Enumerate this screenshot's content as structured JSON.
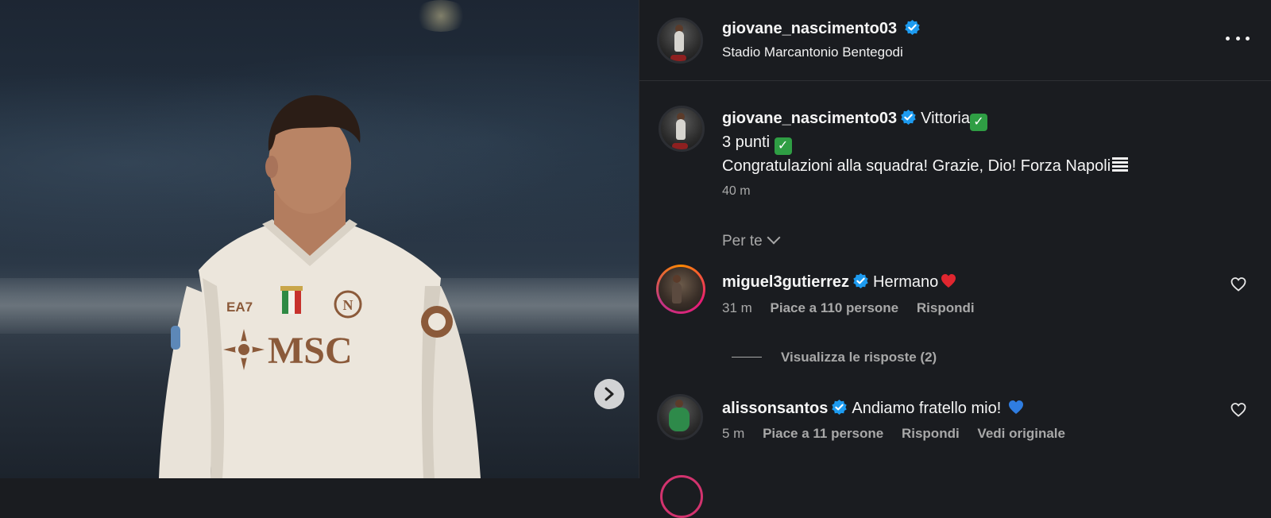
{
  "post": {
    "author": "giovane_nascimento03",
    "location": "Stadio Marcantonio Bentegodi",
    "caption_lines": [
      "Vittoria",
      "3 punti",
      "Congratulazioni alla squadra! Grazie, Dio! Forza Napoli"
    ],
    "caption_time": "40 m",
    "per_te": "Per te"
  },
  "comments": [
    {
      "username": "miguel3gutierrez",
      "text": "Hermano",
      "time": "31 m",
      "likes": "Piace a 110 persone",
      "reply": "Rispondi",
      "view_replies": "Visualizza le risposte (2)"
    },
    {
      "username": "alissonsantos",
      "text": "Andiamo fratello mio!",
      "time": "5 m",
      "likes": "Piace a 11 persone",
      "reply": "Rispondi",
      "see_original": "Vedi originale"
    }
  ],
  "jersey": {
    "sponsor": "MSC",
    "kit_brand": "EA7"
  },
  "icons": {
    "verified": "verified-badge-icon",
    "more": "more-options-icon",
    "next": "chevron-right-icon",
    "like": "heart-outline-icon",
    "check": "check-mark-emoji",
    "red_heart": "red-heart-emoji",
    "blue_heart": "blue-heart-emoji"
  },
  "colors": {
    "background": "#1a1c20",
    "verified": "#1d9bf0",
    "muted_text": "#a8a8a8"
  }
}
